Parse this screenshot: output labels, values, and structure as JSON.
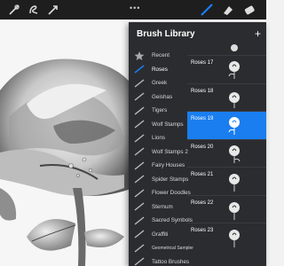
{
  "toolbar": {
    "icons": [
      "adjustments-icon",
      "selection-icon",
      "transform-icon",
      "brush-icon",
      "smudge-icon",
      "eraser-icon"
    ]
  },
  "brush_library": {
    "title": "Brush Library",
    "sets": [
      {
        "label": "Recent",
        "icon": "star-icon"
      },
      {
        "label": "Roses",
        "icon": "brush-stroke-icon"
      },
      {
        "label": "Greek",
        "icon": "brush-stroke-icon"
      },
      {
        "label": "Geishas",
        "icon": "brush-stroke-icon"
      },
      {
        "label": "Tigers",
        "icon": "brush-stroke-icon"
      },
      {
        "label": "Wolf Stamps",
        "icon": "brush-stroke-icon"
      },
      {
        "label": "Lions",
        "icon": "brush-stroke-icon"
      },
      {
        "label": "Wolf Stamps 2",
        "icon": "brush-stroke-icon"
      },
      {
        "label": "Fairy Houses",
        "icon": "brush-stroke-icon"
      },
      {
        "label": "Spider Stamps",
        "icon": "brush-stroke-icon"
      },
      {
        "label": "Flower Doodles",
        "icon": "brush-stroke-icon"
      },
      {
        "label": "Sternum",
        "icon": "brush-stroke-icon"
      },
      {
        "label": "Sacred Symbols",
        "icon": "brush-stroke-icon"
      },
      {
        "label": "Graffiti",
        "icon": "brush-stroke-icon"
      },
      {
        "label": "Geometrical Sampler",
        "icon": "brush-stroke-icon"
      },
      {
        "label": "Tattoo Brushes",
        "icon": "brush-stroke-icon"
      }
    ],
    "brushes": [
      {
        "label": "Roses 17"
      },
      {
        "label": "Roses 18"
      },
      {
        "label": "Roses 19"
      },
      {
        "label": "Roses 20"
      },
      {
        "label": "Roses 21"
      },
      {
        "label": "Roses 22"
      },
      {
        "label": "Roses 23"
      }
    ],
    "selected_set": "Roses",
    "selected_brush": "Roses 19"
  },
  "colors": {
    "accent": "#1a7ef0",
    "panel": "#2b2c30",
    "topbar": "#1e1e1e"
  }
}
